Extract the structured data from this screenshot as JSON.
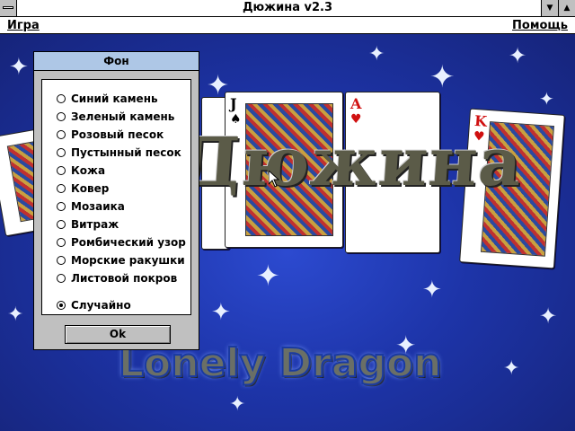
{
  "window": {
    "title": "Дюжина v2.3",
    "system_menu_icon": "system-menu-icon",
    "minimize_icon": "minimize-icon",
    "maximize_icon": "maximize-icon"
  },
  "menubar": {
    "game": "Игра",
    "help": "Помощь"
  },
  "background": {
    "logo_text": "Дюжина",
    "brand_text": "Lonely Dragon",
    "cards": [
      {
        "rank": "J",
        "suit": "♠",
        "color": "#000000"
      },
      {
        "rank": "A",
        "suit": "♥",
        "color": "#d01010"
      },
      {
        "rank": "K",
        "suit": "♥",
        "color": "#d01010"
      }
    ]
  },
  "dialog": {
    "title": "Фон",
    "options": [
      "Синий камень",
      "Зеленый камень",
      "Розовый песок",
      "Пустынный песок",
      "Кожа",
      "Ковер",
      "Мозаика",
      "Витраж",
      "Ромбический узор",
      "Морские ракушки",
      "Листовой покров",
      "Случайно"
    ],
    "selected": "Случайно",
    "ok_label": "Ok"
  }
}
